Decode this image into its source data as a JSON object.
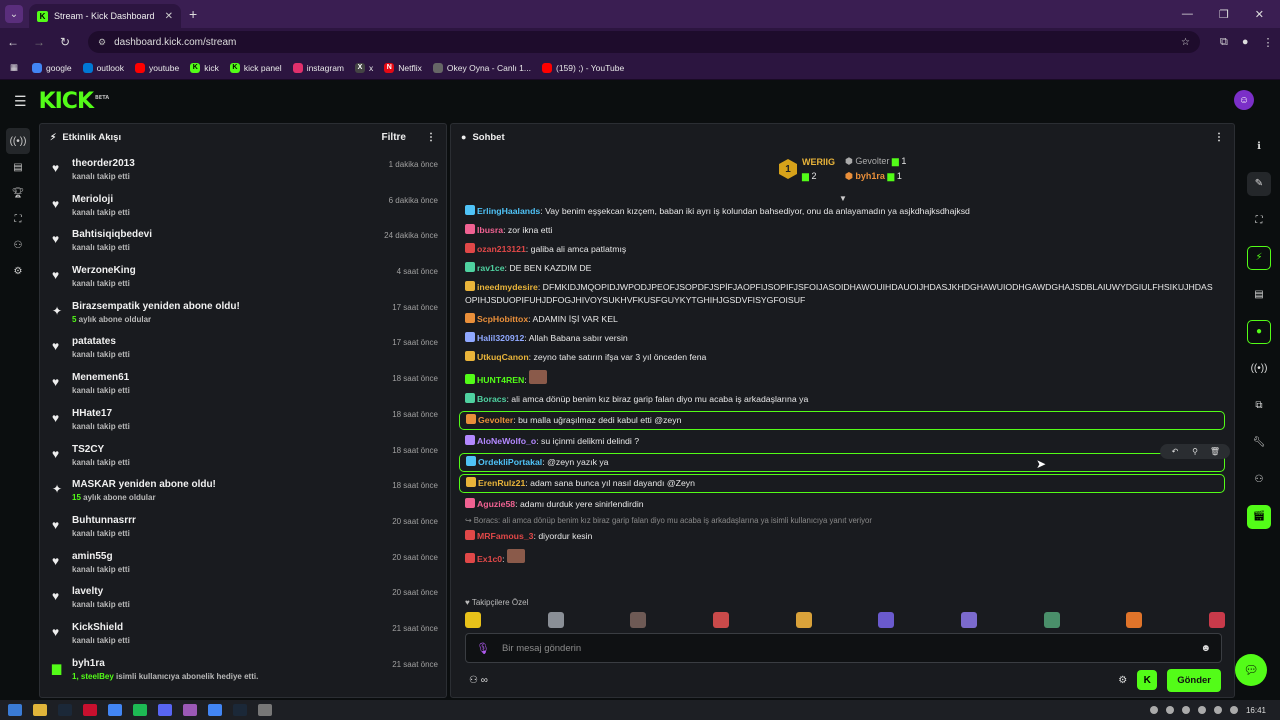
{
  "browser": {
    "tab_title": "Stream - Kick Dashboard",
    "url": "dashboard.kick.com/stream",
    "bookmarks": [
      {
        "label": "google",
        "color": "#4285f4"
      },
      {
        "label": "outlook",
        "color": "#0078d4"
      },
      {
        "label": "youtube",
        "color": "#ff0000"
      },
      {
        "label": "kick",
        "color": "#53fc18"
      },
      {
        "label": "kick panel",
        "color": "#53fc18"
      },
      {
        "label": "instagram",
        "color": "#e1306c"
      },
      {
        "label": "x",
        "color": "#444444"
      },
      {
        "label": "Netflix",
        "color": "#e50914"
      },
      {
        "label": "Okey Oyna - Canlı 1...",
        "color": "#666666"
      },
      {
        "label": "(159) ;) - YouTube",
        "color": "#ff0000"
      }
    ]
  },
  "app": {
    "logo": "KICK",
    "logo_sup": "BETA"
  },
  "activity": {
    "title": "Etkinlik Akışı",
    "filter": "Filtre",
    "items": [
      {
        "name": "theorder2013",
        "sub": "kanalı takip etti",
        "time": "1 dakika önce",
        "type": "follow"
      },
      {
        "name": "Merioloji",
        "sub": "kanalı takip etti",
        "time": "6 dakika önce",
        "type": "follow"
      },
      {
        "name": "Bahtisiqiqbedevi",
        "sub": "kanalı takip etti",
        "time": "24 dakika önce",
        "type": "follow"
      },
      {
        "name": "WerzoneKing",
        "sub": "kanalı takip etti",
        "time": "4 saat önce",
        "type": "follow"
      },
      {
        "name": "Birazsempatik yeniden abone oldu!",
        "sub_hl": "5",
        "sub": " aylık abone oldular",
        "time": "17 saat önce",
        "type": "sub"
      },
      {
        "name": "patatates",
        "sub": "kanalı takip etti",
        "time": "17 saat önce",
        "type": "follow"
      },
      {
        "name": "Menemen61",
        "sub": "kanalı takip etti",
        "time": "18 saat önce",
        "type": "follow"
      },
      {
        "name": "HHate17",
        "sub": "kanalı takip etti",
        "time": "18 saat önce",
        "type": "follow"
      },
      {
        "name": "TS2CY",
        "sub": "kanalı takip etti",
        "time": "18 saat önce",
        "type": "follow"
      },
      {
        "name": "MASKAR yeniden abone oldu!",
        "sub_hl": "15",
        "sub": " aylık abone oldular",
        "time": "18 saat önce",
        "type": "sub"
      },
      {
        "name": "Buhtunnasrrr",
        "sub": "kanalı takip etti",
        "time": "20 saat önce",
        "type": "follow"
      },
      {
        "name": "amin55g",
        "sub": "kanalı takip etti",
        "time": "20 saat önce",
        "type": "follow"
      },
      {
        "name": "lavelty",
        "sub": "kanalı takip etti",
        "time": "20 saat önce",
        "type": "follow"
      },
      {
        "name": "KickShield",
        "sub": "kanalı takip etti",
        "time": "21 saat önce",
        "type": "follow"
      },
      {
        "name": "byh1ra",
        "sub_hl": "1, steelBey",
        "sub": " isimli kullanıcıya abonelik hediye etti.",
        "time": "21 saat önce",
        "type": "gift"
      }
    ]
  },
  "chat": {
    "title": "Sohbet",
    "leaderboard": {
      "first": {
        "rank": "1",
        "name": "WERIIG",
        "count": "2"
      },
      "second": {
        "name": "Gevolter",
        "count": "1"
      },
      "third": {
        "name": "byh1ra",
        "count": "1"
      }
    },
    "messages": [
      {
        "user": "ErlingHaalands",
        "color": "#4fc3f7",
        "text": "Vay benim eşşekcan kızçem, baban iki ayrı iş kolundan bahsediyor, onu da anlayamadın ya asjkdhajksdhajksd"
      },
      {
        "user": "Ibusra",
        "color": "#f06292",
        "text": "zor ikna etti"
      },
      {
        "user": "ozan213121",
        "color": "#e04848",
        "text": "galiba ali amca patlatmış"
      },
      {
        "user": "rav1ce",
        "color": "#4fd1a0",
        "text": "DE BEN KAZDIM DE"
      },
      {
        "user": "ineedmydesire",
        "color": "#e9b43a",
        "text": "DFMKIDJMQOPIDJWPODJPEOFJSOPDFJSPİFJAOPFIJSOPIFJSFOIJASOIDHAWOUIHDAUOIJHDASJKHDGHAWUIODHGAWDGHAJSDBLAIUWYDGIULFHSIKUJHDASOPIHJSDUOPIFUHJDFOGJHIVOYSUKHVFKUSFGUYKYTGHIHJGSDVFISYGFOISUF"
      },
      {
        "user": "ScpHobittox",
        "color": "#e98f3a",
        "text": "ADAMIN İŞİ VAR KEL"
      },
      {
        "user": "Halil320912",
        "color": "#8fa8ff",
        "text": "Allah Babana sabır versin"
      },
      {
        "user": "UtkuqCanon",
        "color": "#e9b43a",
        "text": "zeyno tahe satırın ifşa var 3 yıl önceden fena"
      },
      {
        "user": "HUNT4REN",
        "color": "#53fc18",
        "text": ""
      },
      {
        "user": "Boracs",
        "color": "#4fd1a0",
        "text": "ali amca dönüp benim kız biraz garip falan diyo mu acaba iş arkadaşlarına ya"
      },
      {
        "user": "Gevolter",
        "color": "#e98f3a",
        "text": "bu malla uğraşılmaz dedi kabul etti @zeyn",
        "boxed": true
      },
      {
        "user": "AloNeWolfo_o",
        "color": "#b388ff",
        "text": "su içinmi delikmi delindi ?"
      },
      {
        "user": "OrdekliPortakal",
        "color": "#4fc3f7",
        "text": "@zeyn yazık ya",
        "boxed": true
      },
      {
        "user": "ErenRulz21",
        "color": "#e9b43a",
        "text": "adam sana bunca yıl nasıl dayandı @Zeyn",
        "boxed": true
      },
      {
        "user": "Aguzie58",
        "color": "#f06292",
        "text": "adamı durduk yere sinirlendirdin"
      },
      {
        "reply": "Boracs: ali amca dönüp benim kız biraz garip falan diyo mu acaba iş arkadaşlarına ya isimli kullanıcıya yanıt veriyor"
      },
      {
        "user": "MRFamous_3",
        "color": "#e04848",
        "text": "diyordur kesin"
      },
      {
        "user": "Ex1c0",
        "color": "#e04848",
        "text": ""
      }
    ],
    "followers_only": "Takipçilere Özel",
    "input_placeholder": "Bir mesaj gönderin",
    "send": "Gönder"
  },
  "taskbar": {
    "time": "16:41"
  }
}
